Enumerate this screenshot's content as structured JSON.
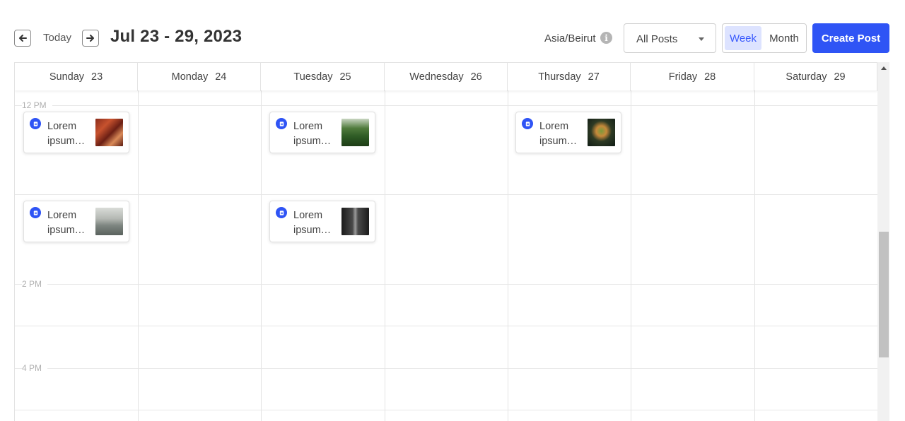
{
  "toolbar": {
    "prev_icon": "arrow-left-icon",
    "today_label": "Today",
    "next_icon": "arrow-right-icon",
    "date_range": "Jul 23 - 29, 2023",
    "timezone": "Asia/Beirut",
    "info_icon": "info-icon",
    "filter": {
      "selected": "All Posts",
      "icon": "caret-down-icon"
    },
    "views": {
      "week": "Week",
      "month": "Month",
      "active": "Week"
    },
    "create_label": "Create Post",
    "accent_color": "#2f54f5"
  },
  "calendar": {
    "days": [
      {
        "name": "Sunday",
        "date": "23"
      },
      {
        "name": "Monday",
        "date": "24"
      },
      {
        "name": "Tuesday",
        "date": "25"
      },
      {
        "name": "Wednesday",
        "date": "26"
      },
      {
        "name": "Thursday",
        "date": "27"
      },
      {
        "name": "Friday",
        "date": "28"
      },
      {
        "name": "Saturday",
        "date": "29"
      }
    ],
    "time_labels": [
      "12 PM",
      "2 PM",
      "4 PM"
    ],
    "posts": [
      {
        "day": "Sunday",
        "text": "Lorem ipsum…",
        "icon": "post-icon",
        "thumb": "red-lantern-image"
      },
      {
        "day": "Tuesday",
        "text": "Lorem ipsum…",
        "icon": "post-icon",
        "thumb": "forest-image"
      },
      {
        "day": "Thursday",
        "text": "Lorem ipsum…",
        "icon": "post-icon",
        "thumb": "cake-image"
      },
      {
        "day": "Sunday",
        "text": "Lorem ipsum…",
        "icon": "post-icon",
        "thumb": "misty-mountain-image"
      },
      {
        "day": "Tuesday",
        "text": "Lorem ipsum…",
        "icon": "post-icon",
        "thumb": "dark-road-image"
      }
    ]
  }
}
